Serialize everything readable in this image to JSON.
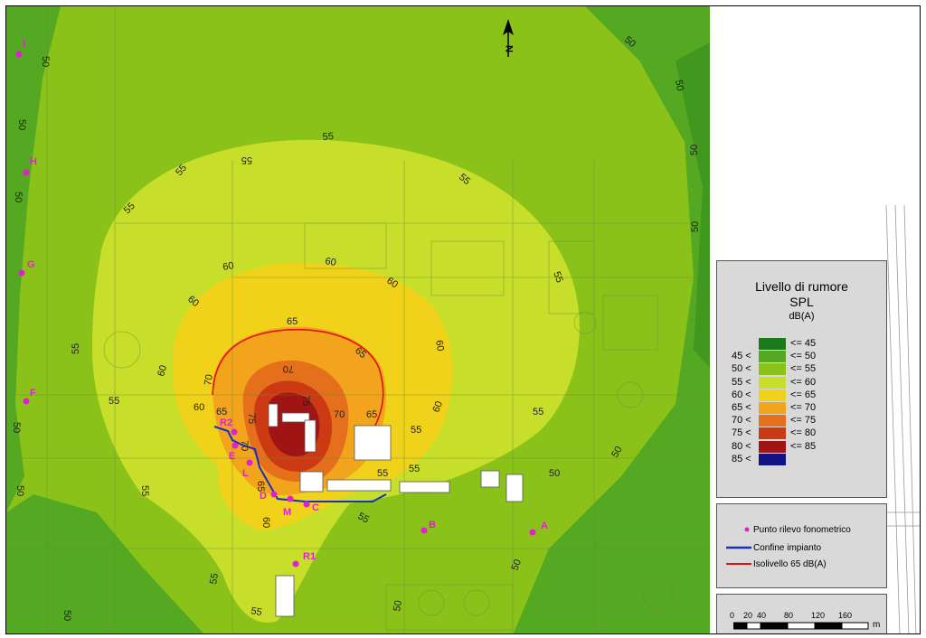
{
  "legend": {
    "title_line1": "Livello di rumore",
    "title_line2": "SPL",
    "unit": "dB(A)",
    "classes": [
      {
        "lower": "",
        "upper": "<= 45",
        "color": "#1b7a1b"
      },
      {
        "lower": "45 <",
        "upper": "<= 50",
        "color": "#55a821"
      },
      {
        "lower": "50 <",
        "upper": "<= 55",
        "color": "#8bc21a"
      },
      {
        "lower": "55 <",
        "upper": "<= 60",
        "color": "#c7df2a"
      },
      {
        "lower": "60 <",
        "upper": "<= 65",
        "color": "#f0d21a"
      },
      {
        "lower": "65 <",
        "upper": "<= 70",
        "color": "#f2a51c"
      },
      {
        "lower": "70 <",
        "upper": "<= 75",
        "color": "#e4701c"
      },
      {
        "lower": "75 <",
        "upper": "<= 80",
        "color": "#cc3a14"
      },
      {
        "lower": "80 <",
        "upper": "<= 85",
        "color": "#a01414"
      },
      {
        "lower": "85 <",
        "upper": "",
        "color": "#121283"
      }
    ]
  },
  "key": {
    "point_label": "Punto rilevo fonometrico",
    "boundary_label": "Confine impianto",
    "isolevel_label": "Isolivello 65 dB(A)",
    "point_color": "#e020d0",
    "boundary_color": "#1a2fbf",
    "isolevel_color": "#e01010"
  },
  "scale": {
    "ticks": [
      "0",
      "20",
      "40",
      "80",
      "120",
      "160"
    ],
    "unit": "m"
  },
  "north_label": "N",
  "measurement_points": [
    "I",
    "H",
    "G",
    "F",
    "R2",
    "E",
    "L",
    "D",
    "M",
    "C",
    "B",
    "A",
    "R1"
  ],
  "contour_labels": [
    "50",
    "55",
    "60",
    "65",
    "70",
    "75"
  ]
}
